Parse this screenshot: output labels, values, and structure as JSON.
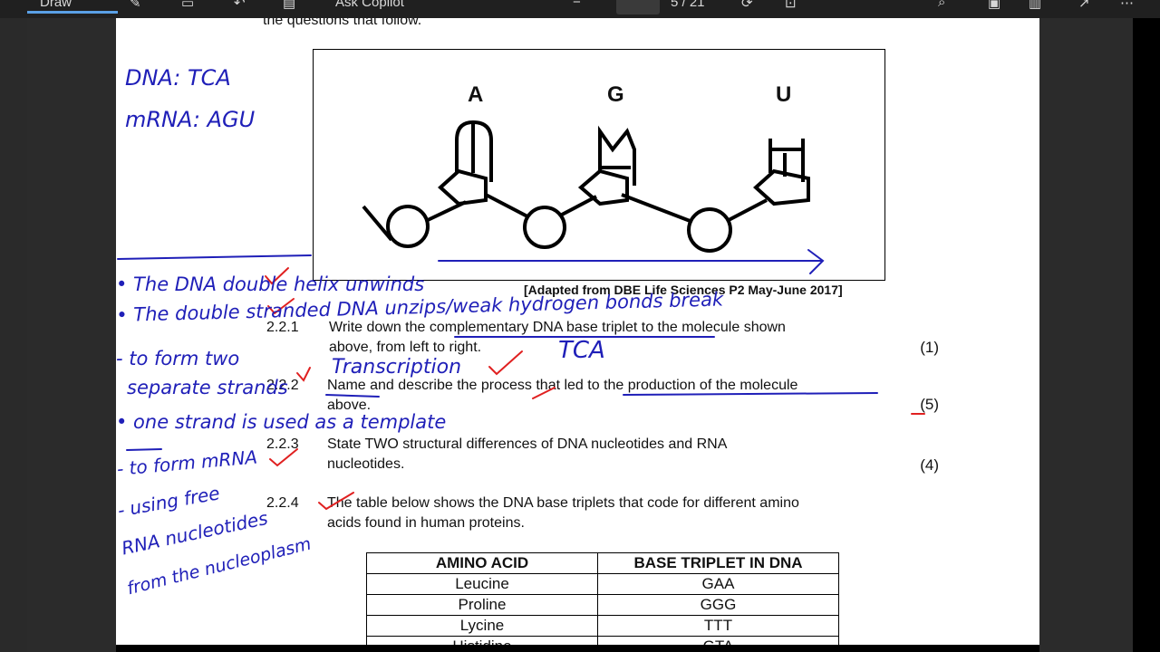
{
  "toolbar": {
    "draw_tab": "Draw",
    "copilot": "Ask Copilot",
    "page_info": "5 / 21"
  },
  "document": {
    "header_line": "the questions that follow.",
    "figure": {
      "bases": [
        "A",
        "G",
        "U"
      ],
      "credit": "[Adapted from DBE Life Sciences P2 May-June 2017]"
    },
    "questions": [
      {
        "num": "2.2.1",
        "line1": "Write down the complementary DNA base triplet to the molecule shown",
        "line2": "above, from left to right.",
        "marks": "(1)"
      },
      {
        "num": "2.2.2",
        "line1": "Name and describe the process that led to the production of the molecule",
        "line2": "above.",
        "marks": "(5)"
      },
      {
        "num": "2.2.3",
        "line1": "State TWO structural differences of DNA nucleotides and RNA",
        "line2": "nucleotides.",
        "marks": "(4)"
      },
      {
        "num": "2.2.4",
        "line1": "The table below shows the DNA base triplets that code for different amino",
        "line2": "acids found in human proteins.",
        "marks": ""
      }
    ],
    "table": {
      "headers": [
        "AMINO ACID",
        "BASE TRIPLET IN DNA"
      ],
      "rows": [
        [
          "Leucine",
          "GAA"
        ],
        [
          "Proline",
          "GGG"
        ],
        [
          "Lycine",
          "TTT"
        ],
        [
          "Histidine",
          "GTA"
        ]
      ]
    }
  },
  "annotations": {
    "dna": "DNA: TCA",
    "mrna": "mRNA: AGU",
    "answer_221": "TCA",
    "answer_222": "Transcription",
    "notes": [
      "• The DNA double helix unwinds",
      "• The double stranded DNA unzips/weak hydrogen bonds break",
      "- to form two",
      "separate strands",
      "• one strand is used as a template",
      "- to form mRNA",
      "- using free",
      "RNA nucleotides",
      "from the nucleoplasm"
    ]
  },
  "colors": {
    "ink_blue": "#1f1fb8",
    "ink_red": "#e02020"
  }
}
